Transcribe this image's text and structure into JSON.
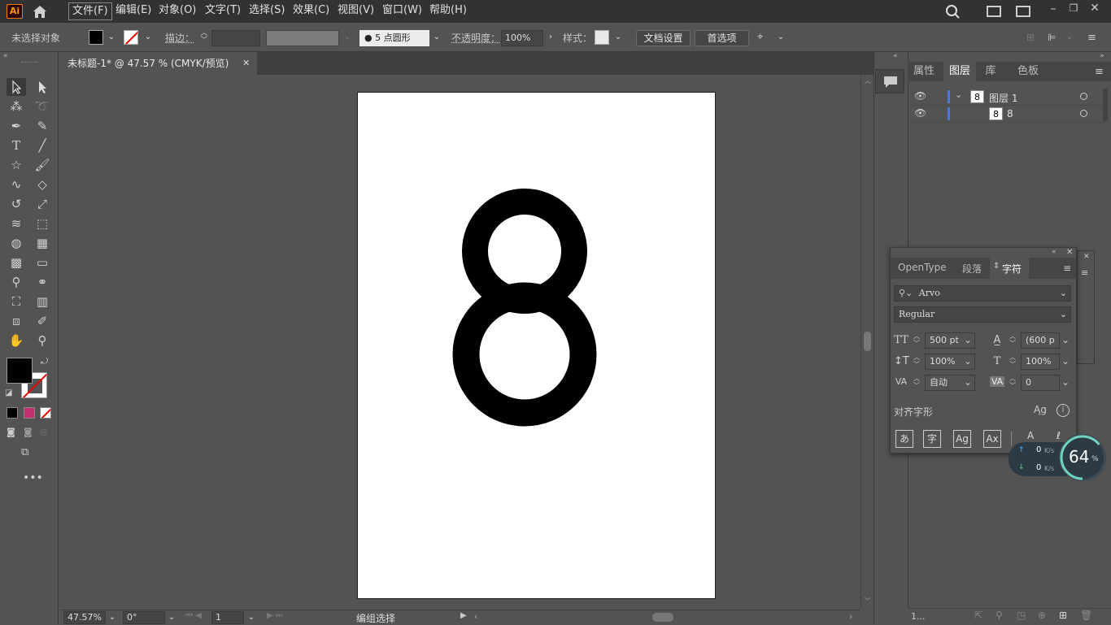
{
  "app": {
    "logo": "Ai"
  },
  "menu": {
    "items": [
      "文件(F)",
      "编辑(E)",
      "对象(O)",
      "文字(T)",
      "选择(S)",
      "效果(C)",
      "视图(V)",
      "窗口(W)",
      "帮助(H)"
    ]
  },
  "control": {
    "selection_label": "未选择对象",
    "stroke_label": "描边：",
    "brush_value": "5 点圆形",
    "opacity_label": "不透明度：",
    "opacity_value": "100%",
    "style_label": "样式：",
    "doc_setup_label": "文档设置",
    "preferences_label": "首选项"
  },
  "document": {
    "tab_title": "未标题-1* @ 47.57 % (CMYK/预览)",
    "artboard_glyph": "8"
  },
  "status": {
    "zoom": "47.57%",
    "rotation": "0°",
    "artboard_num": "1",
    "tool_name": "编组选择"
  },
  "right_panel": {
    "tabs": [
      "属性",
      "图层",
      "库",
      "色板"
    ],
    "active_tab": "图层",
    "layers": [
      {
        "name": "图层 1",
        "thumb": "8"
      },
      {
        "name": "8",
        "thumb": "8"
      }
    ],
    "footer_label": "1..."
  },
  "char_panel": {
    "tabs": [
      "OpenType",
      "段落",
      "字符"
    ],
    "active_tab": "字符",
    "font_family": "Arvo",
    "font_style": "Regular",
    "font_size": "500 pt",
    "leading": "(600 p",
    "vscale": "100%",
    "hscale": "100%",
    "kerning": "自动",
    "tracking": "0",
    "align_glyph_label": "对齐字形",
    "glyph_buttons": [
      "あ",
      "字",
      "Ag",
      "Ax"
    ]
  },
  "net_widget": {
    "up": "0",
    "down": "0",
    "unit": "K/s",
    "cpu": "64",
    "cpu_unit": "%"
  },
  "colors": {
    "app_bg": "#535353",
    "menubar_bg": "#323232",
    "accent_blue": "#4b7bd8",
    "logo_orange": "#ff9a00"
  }
}
